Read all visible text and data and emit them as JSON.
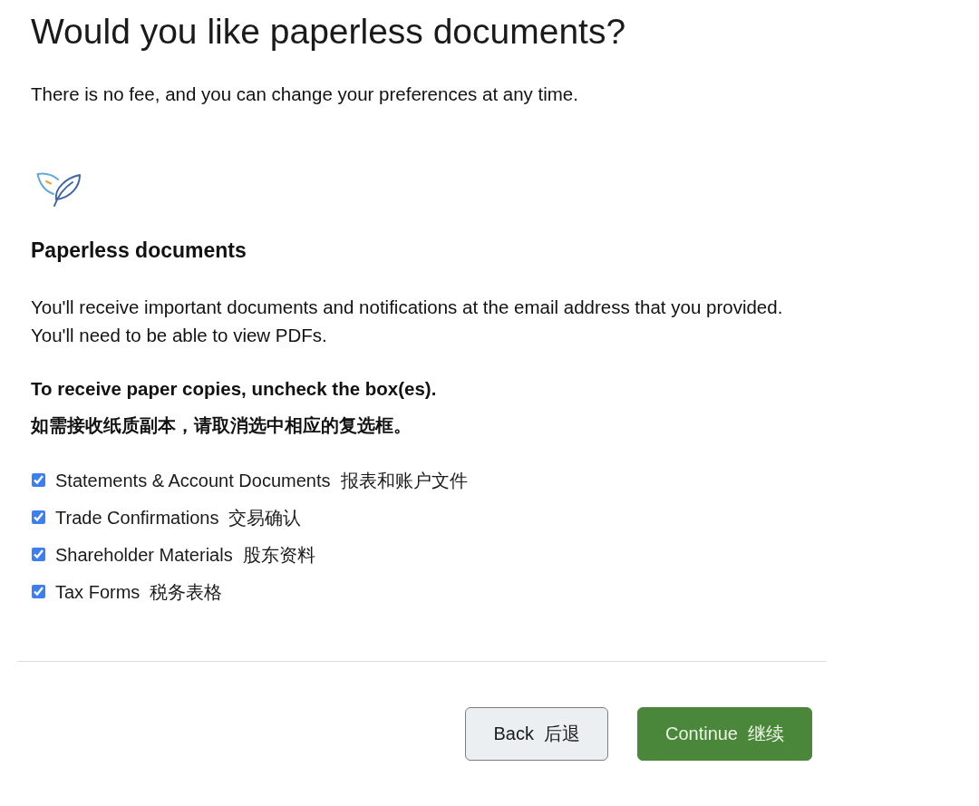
{
  "title": "Would you like paperless documents?",
  "subtitle": "There is no fee, and you can change your preferences at any time.",
  "section": {
    "heading": "Paperless documents",
    "description": [
      "You'll receive important documents and notifications at the email address that you provided.",
      "You'll need to be able to view PDFs."
    ],
    "instruction": "To receive paper copies, uncheck the box(es).",
    "instruction_zh": "如需接收纸质副本，请取消选中相应的复选框。"
  },
  "options": [
    {
      "label": "Statements & Account Documents",
      "label_zh": "报表和账户文件",
      "checked": true
    },
    {
      "label": "Trade Confirmations",
      "label_zh": "交易确认",
      "checked": true
    },
    {
      "label": "Shareholder Materials",
      "label_zh": "股东资料",
      "checked": true
    },
    {
      "label": "Tax Forms",
      "label_zh": "税务表格",
      "checked": true
    }
  ],
  "buttons": [
    {
      "kind": "secondary",
      "label": "Back",
      "label_zh": "后退"
    },
    {
      "kind": "primary",
      "label": "Continue",
      "label_zh": "继续"
    }
  ]
}
